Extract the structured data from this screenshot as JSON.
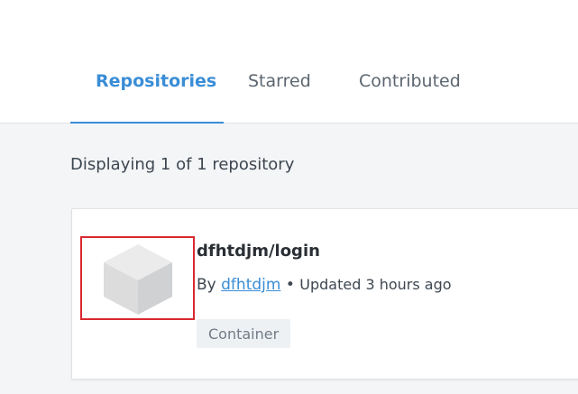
{
  "tabs": [
    {
      "label": "Repositories",
      "active": true
    },
    {
      "label": "Starred",
      "active": false
    },
    {
      "label": "Contributed",
      "active": false
    }
  ],
  "summary": "Displaying 1 of 1 repository",
  "repo": {
    "name": "dfhtdjm/login",
    "by_label": "By",
    "owner": "dfhtdjm",
    "separator": "•",
    "updated": "Updated 3 hours ago",
    "type_badge": "Container",
    "icon": "cube-icon"
  },
  "colors": {
    "accent": "#3a8dd6",
    "highlight_border": "#d9282f"
  }
}
